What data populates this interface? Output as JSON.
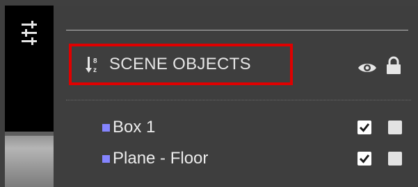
{
  "panel": {
    "section_title": "SCENE OBJECTS",
    "highlight_color": "#e00000"
  },
  "objects": [
    {
      "label": "Box 1",
      "visible": true,
      "locked": false
    },
    {
      "label": "Plane - Floor",
      "visible": true,
      "locked": false
    }
  ],
  "icons": {
    "toolbar": "sliders-icon",
    "sort": "sort-descending-icon",
    "visibility_header": "eye-icon",
    "lock_header": "lock-icon"
  },
  "colors": {
    "panel_background": "#3e3e3e",
    "toolbar_background": "#000000",
    "object_marker": "#8585ff",
    "text": "#e6e6e6"
  }
}
